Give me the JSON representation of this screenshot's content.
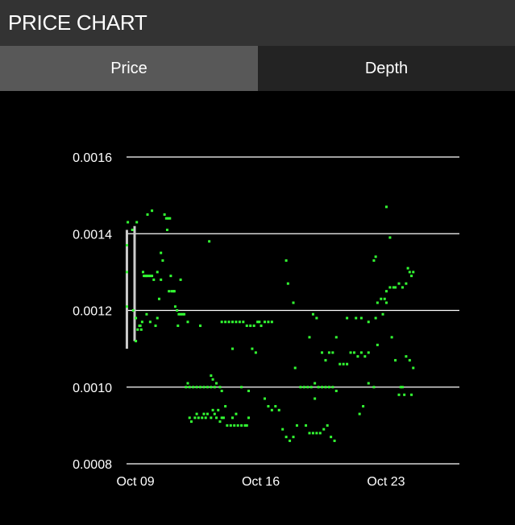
{
  "header": {
    "title": "PRICE CHART"
  },
  "tabs": [
    {
      "label": "Price",
      "active": true
    },
    {
      "label": "Depth",
      "active": false
    }
  ],
  "colors": {
    "trade": "#33ff33",
    "wick": "#cccccc",
    "grid": "#ffffff",
    "background": "#000000"
  },
  "chart_data": {
    "type": "scatter",
    "title": "",
    "xlabel": "",
    "ylabel": "",
    "x_unit": "date",
    "x_start": "Oct 08",
    "x_ticks": [
      {
        "label": "Oct 09",
        "value": 1
      },
      {
        "label": "Oct 16",
        "value": 8
      },
      {
        "label": "Oct 23",
        "value": 15
      }
    ],
    "xlim": [
      0.5,
      19.1
    ],
    "ylim": [
      0.0008,
      0.00165
    ],
    "y_ticks": [
      {
        "label": "0.0008",
        "value": 0.0008
      },
      {
        "label": "0.0010",
        "value": 0.001
      },
      {
        "label": "0.0012",
        "value": 0.0012
      },
      {
        "label": "0.0014",
        "value": 0.0014
      },
      {
        "label": "0.0016",
        "value": 0.0016
      }
    ],
    "grid": true,
    "wicks": [
      {
        "x": 0.52,
        "low": 0.0011,
        "high": 0.00141
      },
      {
        "x": 0.95,
        "low": 0.00112,
        "high": 0.00142
      }
    ],
    "series": [
      {
        "points": [
          [
            0.5,
            0.00137
          ],
          [
            0.5,
            0.0013
          ],
          [
            0.5,
            0.00121
          ],
          [
            0.55,
            0.00143
          ],
          [
            0.8,
            0.00141
          ],
          [
            0.85,
            0.0012
          ],
          [
            1.0,
            0.00118
          ],
          [
            1.0,
            0.00112
          ],
          [
            1.05,
            0.00143
          ],
          [
            1.1,
            0.00115
          ],
          [
            1.2,
            0.00116
          ],
          [
            1.25,
            0.00116
          ],
          [
            1.3,
            0.00115
          ],
          [
            1.35,
            0.00117
          ],
          [
            1.4,
            0.0013
          ],
          [
            1.45,
            0.00129
          ],
          [
            1.55,
            0.00129
          ],
          [
            1.6,
            0.00129
          ],
          [
            1.7,
            0.00129
          ],
          [
            1.8,
            0.00129
          ],
          [
            1.9,
            0.00129
          ],
          [
            2.0,
            0.00128
          ],
          [
            1.6,
            0.00119
          ],
          [
            1.8,
            0.00117
          ],
          [
            2.1,
            0.00116
          ],
          [
            2.2,
            0.00118
          ],
          [
            1.65,
            0.00145
          ],
          [
            1.9,
            0.00146
          ],
          [
            2.2,
            0.0013
          ],
          [
            2.3,
            0.00123
          ],
          [
            2.4,
            0.00128
          ],
          [
            2.4,
            0.00135
          ],
          [
            2.5,
            0.00133
          ],
          [
            2.6,
            0.00145
          ],
          [
            2.7,
            0.00144
          ],
          [
            2.75,
            0.00141
          ],
          [
            2.8,
            0.00144
          ],
          [
            2.9,
            0.00144
          ],
          [
            2.85,
            0.00125
          ],
          [
            3.0,
            0.00125
          ],
          [
            3.1,
            0.00125
          ],
          [
            3.15,
            0.00125
          ],
          [
            2.95,
            0.00129
          ],
          [
            3.2,
            0.00121
          ],
          [
            3.3,
            0.0012
          ],
          [
            3.4,
            0.00119
          ],
          [
            3.5,
            0.00119
          ],
          [
            3.6,
            0.00119
          ],
          [
            3.7,
            0.00119
          ],
          [
            3.35,
            0.00116
          ],
          [
            3.5,
            0.00128
          ],
          [
            3.9,
            0.00117
          ],
          [
            3.8,
            0.001
          ],
          [
            3.9,
            0.00101
          ],
          [
            4.0,
            0.001
          ],
          [
            4.2,
            0.001
          ],
          [
            4.4,
            0.001
          ],
          [
            4.6,
            0.001
          ],
          [
            4.8,
            0.001
          ],
          [
            5.0,
            0.001
          ],
          [
            5.2,
            0.001
          ],
          [
            5.4,
            0.001
          ],
          [
            5.5,
            0.00101
          ],
          [
            5.7,
            0.001
          ],
          [
            5.8,
            0.00099
          ],
          [
            5.3,
            0.00102
          ],
          [
            5.2,
            0.00103
          ],
          [
            4.6,
            0.00116
          ],
          [
            5.1,
            0.00138
          ],
          [
            4.0,
            0.00092
          ],
          [
            4.1,
            0.00091
          ],
          [
            4.3,
            0.00092
          ],
          [
            4.4,
            0.00093
          ],
          [
            4.5,
            0.00092
          ],
          [
            4.7,
            0.00092
          ],
          [
            4.8,
            0.00093
          ],
          [
            4.9,
            0.00092
          ],
          [
            5.0,
            0.00093
          ],
          [
            5.2,
            0.00092
          ],
          [
            5.4,
            0.00093
          ],
          [
            5.5,
            0.00092
          ],
          [
            5.7,
            0.00091
          ],
          [
            5.8,
            0.00092
          ],
          [
            5.9,
            0.00092
          ],
          [
            6.0,
            0.00095
          ],
          [
            5.3,
            0.00094
          ],
          [
            5.6,
            0.00094
          ],
          [
            6.1,
            0.0009
          ],
          [
            6.3,
            0.0009
          ],
          [
            6.5,
            0.0009
          ],
          [
            6.7,
            0.0009
          ],
          [
            6.9,
            0.0009
          ],
          [
            7.1,
            0.0009
          ],
          [
            7.2,
            0.0009
          ],
          [
            6.4,
            0.00092
          ],
          [
            6.6,
            0.00093
          ],
          [
            7.3,
            0.00092
          ],
          [
            5.8,
            0.00117
          ],
          [
            6.0,
            0.00117
          ],
          [
            6.2,
            0.00117
          ],
          [
            6.4,
            0.00117
          ],
          [
            6.6,
            0.00117
          ],
          [
            6.8,
            0.00117
          ],
          [
            7.0,
            0.00117
          ],
          [
            7.2,
            0.00116
          ],
          [
            7.4,
            0.00116
          ],
          [
            7.6,
            0.00116
          ],
          [
            7.8,
            0.00117
          ],
          [
            6.4,
            0.0011
          ],
          [
            6.9,
            0.001
          ],
          [
            7.3,
            0.00099
          ],
          [
            7.5,
            0.0011
          ],
          [
            7.7,
            0.00109
          ],
          [
            7.9,
            0.00117
          ],
          [
            8.0,
            0.00116
          ],
          [
            8.2,
            0.00117
          ],
          [
            8.4,
            0.00117
          ],
          [
            8.6,
            0.00117
          ],
          [
            8.2,
            0.00097
          ],
          [
            8.4,
            0.00095
          ],
          [
            8.6,
            0.00094
          ],
          [
            8.8,
            0.00095
          ],
          [
            9.0,
            0.00094
          ],
          [
            9.2,
            0.00089
          ],
          [
            9.4,
            0.00087
          ],
          [
            9.6,
            0.00086
          ],
          [
            9.8,
            0.00087
          ],
          [
            10.0,
            0.0009
          ],
          [
            9.4,
            0.00133
          ],
          [
            9.5,
            0.00127
          ],
          [
            9.8,
            0.00122
          ],
          [
            9.9,
            0.00105
          ],
          [
            10.2,
            0.001
          ],
          [
            10.4,
            0.001
          ],
          [
            10.6,
            0.001
          ],
          [
            10.8,
            0.001
          ],
          [
            11.0,
            0.00101
          ],
          [
            11.2,
            0.001
          ],
          [
            11.4,
            0.001
          ],
          [
            11.6,
            0.001
          ],
          [
            11.8,
            0.001
          ],
          [
            12.0,
            0.001
          ],
          [
            12.2,
            0.00099
          ],
          [
            11.0,
            0.00097
          ],
          [
            10.5,
            0.0009
          ],
          [
            10.7,
            0.00088
          ],
          [
            10.9,
            0.00088
          ],
          [
            11.1,
            0.00088
          ],
          [
            11.3,
            0.00088
          ],
          [
            11.5,
            0.00089
          ],
          [
            11.7,
            0.0009
          ],
          [
            11.9,
            0.00087
          ],
          [
            12.1,
            0.00086
          ],
          [
            10.7,
            0.00113
          ],
          [
            10.9,
            0.00119
          ],
          [
            11.1,
            0.00118
          ],
          [
            11.4,
            0.00109
          ],
          [
            11.6,
            0.00107
          ],
          [
            11.8,
            0.00109
          ],
          [
            12.0,
            0.00109
          ],
          [
            12.2,
            0.00113
          ],
          [
            12.4,
            0.00106
          ],
          [
            12.6,
            0.00106
          ],
          [
            12.8,
            0.00106
          ],
          [
            12.8,
            0.00118
          ],
          [
            13.0,
            0.00109
          ],
          [
            13.2,
            0.00109
          ],
          [
            13.4,
            0.00108
          ],
          [
            13.6,
            0.00109
          ],
          [
            13.8,
            0.00108
          ],
          [
            14.0,
            0.00109
          ],
          [
            13.3,
            0.00118
          ],
          [
            13.6,
            0.00118
          ],
          [
            14.0,
            0.00117
          ],
          [
            13.5,
            0.00093
          ],
          [
            13.7,
            0.00095
          ],
          [
            14.0,
            0.00101
          ],
          [
            14.3,
            0.001
          ],
          [
            14.5,
            0.00111
          ],
          [
            14.4,
            0.00118
          ],
          [
            14.5,
            0.00122
          ],
          [
            14.7,
            0.00123
          ],
          [
            14.9,
            0.00123
          ],
          [
            15.0,
            0.00122
          ],
          [
            14.8,
            0.00119
          ],
          [
            15.0,
            0.00125
          ],
          [
            15.2,
            0.00126
          ],
          [
            15.4,
            0.00126
          ],
          [
            15.5,
            0.00126
          ],
          [
            15.7,
            0.00127
          ],
          [
            15.9,
            0.00126
          ],
          [
            16.1,
            0.00127
          ],
          [
            16.3,
            0.0013
          ],
          [
            16.5,
            0.0013
          ],
          [
            16.4,
            0.00129
          ],
          [
            15.3,
            0.00113
          ],
          [
            15.5,
            0.00107
          ],
          [
            15.7,
            0.00098
          ],
          [
            15.8,
            0.001
          ],
          [
            15.9,
            0.001
          ],
          [
            16.0,
            0.00098
          ],
          [
            16.1,
            0.00108
          ],
          [
            16.3,
            0.00107
          ],
          [
            16.4,
            0.00098
          ],
          [
            16.5,
            0.00105
          ],
          [
            14.3,
            0.00133
          ],
          [
            14.4,
            0.00134
          ],
          [
            15.0,
            0.00147
          ],
          [
            15.2,
            0.00139
          ],
          [
            16.2,
            0.00131
          ]
        ]
      }
    ]
  }
}
